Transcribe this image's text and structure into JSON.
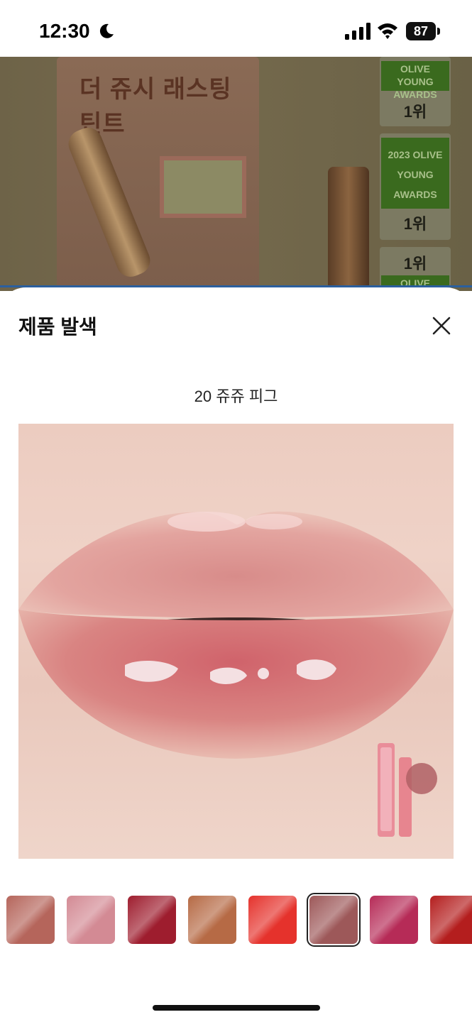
{
  "status_bar": {
    "time": "12:30",
    "battery": "87"
  },
  "background": {
    "box_title": "더 쥬시 래스팅 틴트",
    "awards": [
      {
        "label": "OLIVE YOUNG AWARDS",
        "rank": "1위"
      },
      {
        "label": "2023 OLIVE YOUNG AWARDS",
        "rank": "1위"
      },
      {
        "label": "OLIVE YOUNG",
        "rank": "1위"
      }
    ]
  },
  "sheet": {
    "title": "제품 발색",
    "shade_name": "20 쥬쥬 피그"
  },
  "thumbnails": [
    {
      "color": "#b5655b",
      "selected": false
    },
    {
      "color": "#d38a94",
      "selected": false
    },
    {
      "color": "#9e1d2e",
      "selected": false
    },
    {
      "color": "#b66a45",
      "selected": false
    },
    {
      "color": "#e5322c",
      "selected": false
    },
    {
      "color": "#9d5859",
      "selected": true
    },
    {
      "color": "#b62b57",
      "selected": false
    },
    {
      "color": "#b41e1e",
      "selected": false
    }
  ]
}
